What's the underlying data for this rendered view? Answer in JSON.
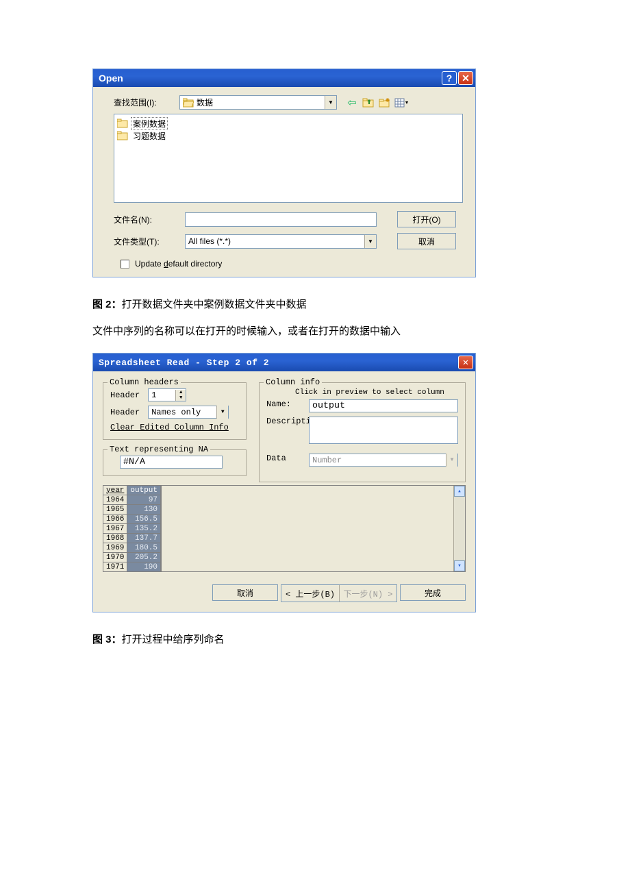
{
  "figure2_caption_prefix": "图 2：",
  "figure2_caption": "打开数据文件夹中案例数据文件夹中数据",
  "body_text": "文件中序列的名称可以在打开的时候输入，或者在打开的数据中输入",
  "figure3_caption_prefix": "图 3：",
  "figure3_caption": "打开过程中给序列命名",
  "open_dialog": {
    "title": "Open",
    "look_in_label": "查找范围(I):",
    "look_in_value": "数据",
    "folders": [
      "案例数据",
      "习题数据"
    ],
    "filename_label": "文件名(N):",
    "filename_value": "",
    "filetype_label": "文件类型(T):",
    "filetype_value": "All files (*.*)",
    "open_button": "打开(O)",
    "cancel_button": "取消",
    "update_default_dir": "Update default directory",
    "update_default_dir_underline_letter": "d"
  },
  "spreadsheet_dialog": {
    "title": "Spreadsheet Read - Step 2 of 2",
    "column_headers_legend": "Column headers",
    "header_label1": "Header",
    "header_row_value": "1",
    "header_label2": "Header",
    "header_mode_value": "Names only",
    "clear_button": "Clear Edited Column Info",
    "na_legend": "Text representing NA",
    "na_value": "#N/A",
    "column_info_legend": "Column info",
    "column_info_hint": "Click in preview to select column",
    "name_label": "Name:",
    "name_value": "output",
    "description_label": "Descriptio",
    "description_value": "",
    "data_label": "Data",
    "data_value": "Number",
    "preview_headers": [
      "year",
      "output"
    ],
    "preview_rows": [
      {
        "year": "1964",
        "output": "97"
      },
      {
        "year": "1965",
        "output": "130"
      },
      {
        "year": "1966",
        "output": "156.5"
      },
      {
        "year": "1967",
        "output": "135.2"
      },
      {
        "year": "1968",
        "output": "137.7"
      },
      {
        "year": "1969",
        "output": "180.5"
      },
      {
        "year": "1970",
        "output": "205.2"
      },
      {
        "year": "1971",
        "output": "190"
      }
    ],
    "cancel_button": "取消",
    "back_button": "< 上一步(B)",
    "next_button": "下一步(N) >",
    "finish_button": "完成"
  }
}
